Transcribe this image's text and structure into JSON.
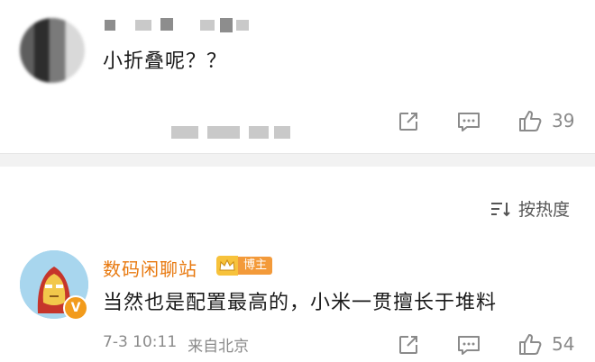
{
  "comment1": {
    "text": "小折叠呢？？",
    "actions": {
      "share_icon": "share-icon",
      "comment_icon": "comment-icon",
      "like_icon": "thumbs-up-icon",
      "like_count": "39"
    }
  },
  "sort": {
    "label": "按热度",
    "icon": "sort-icon"
  },
  "comment2": {
    "username": "数码闲聊站",
    "badge_label": "博主",
    "verified_mark": "V",
    "text": "当然也是配置最高的，小米一贯擅长于堆料",
    "time": "7-3 10:11",
    "source": "来自北京",
    "actions": {
      "share_icon": "share-icon",
      "comment_icon": "comment-icon",
      "like_icon": "thumbs-up-icon",
      "like_count": "54"
    }
  },
  "colors": {
    "username": "#e8790f",
    "badge": "#f39a3a",
    "icon_gray": "#8a8a8a"
  }
}
